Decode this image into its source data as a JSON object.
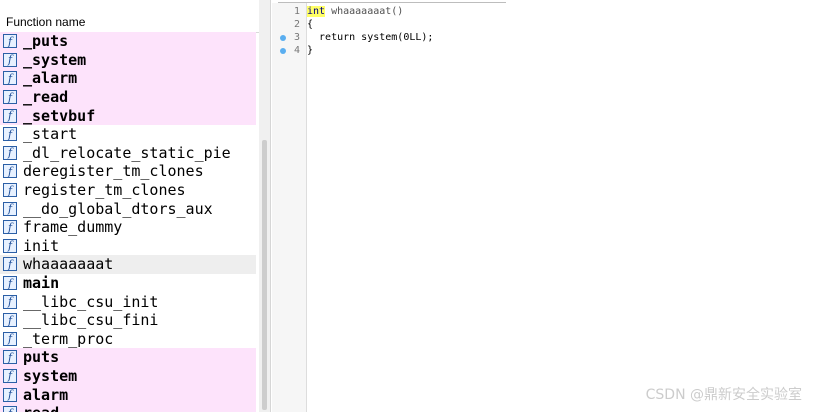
{
  "functions_panel": {
    "header": "Function name",
    "items": [
      {
        "name": "_puts",
        "style": "pink"
      },
      {
        "name": "_system",
        "style": "pink"
      },
      {
        "name": "_alarm",
        "style": "pink"
      },
      {
        "name": "_read",
        "style": "pink"
      },
      {
        "name": "_setvbuf",
        "style": "pink"
      },
      {
        "name": "_start",
        "style": "normal"
      },
      {
        "name": "_dl_relocate_static_pie",
        "style": "normal"
      },
      {
        "name": "deregister_tm_clones",
        "style": "normal"
      },
      {
        "name": "register_tm_clones",
        "style": "normal"
      },
      {
        "name": "__do_global_dtors_aux",
        "style": "normal"
      },
      {
        "name": "frame_dummy",
        "style": "normal"
      },
      {
        "name": "init",
        "style": "normal"
      },
      {
        "name": "whaaaaaaat",
        "style": "selected"
      },
      {
        "name": "main",
        "style": "bold"
      },
      {
        "name": "__libc_csu_init",
        "style": "normal"
      },
      {
        "name": "__libc_csu_fini",
        "style": "normal"
      },
      {
        "name": "_term_proc",
        "style": "normal"
      },
      {
        "name": "puts",
        "style": "pink-bold"
      },
      {
        "name": "system",
        "style": "pink-bold"
      },
      {
        "name": "alarm",
        "style": "pink-bold"
      },
      {
        "name": "read",
        "style": "pink-bold"
      }
    ]
  },
  "code_view": {
    "lines": [
      {
        "num": "1",
        "breakpoint": false,
        "keyword": "int",
        "rest": " whaaaaaaat()"
      },
      {
        "num": "2",
        "breakpoint": false,
        "keyword": "",
        "rest": "{"
      },
      {
        "num": "3",
        "breakpoint": true,
        "keyword": "",
        "rest": "  return system(0LL);"
      },
      {
        "num": "4",
        "breakpoint": true,
        "keyword": "",
        "rest": "}"
      }
    ]
  },
  "watermark": "CSDN @鼎新安全实验室",
  "colors": {
    "pink_row": "#fde3fb",
    "selected_row": "#eeeeee",
    "keyword_highlight": "#ffff66",
    "breakpoint_dot": "#5aaef0"
  },
  "icons": {
    "function": "function-f-icon",
    "breakpoint": "breakpoint-dot-icon"
  }
}
